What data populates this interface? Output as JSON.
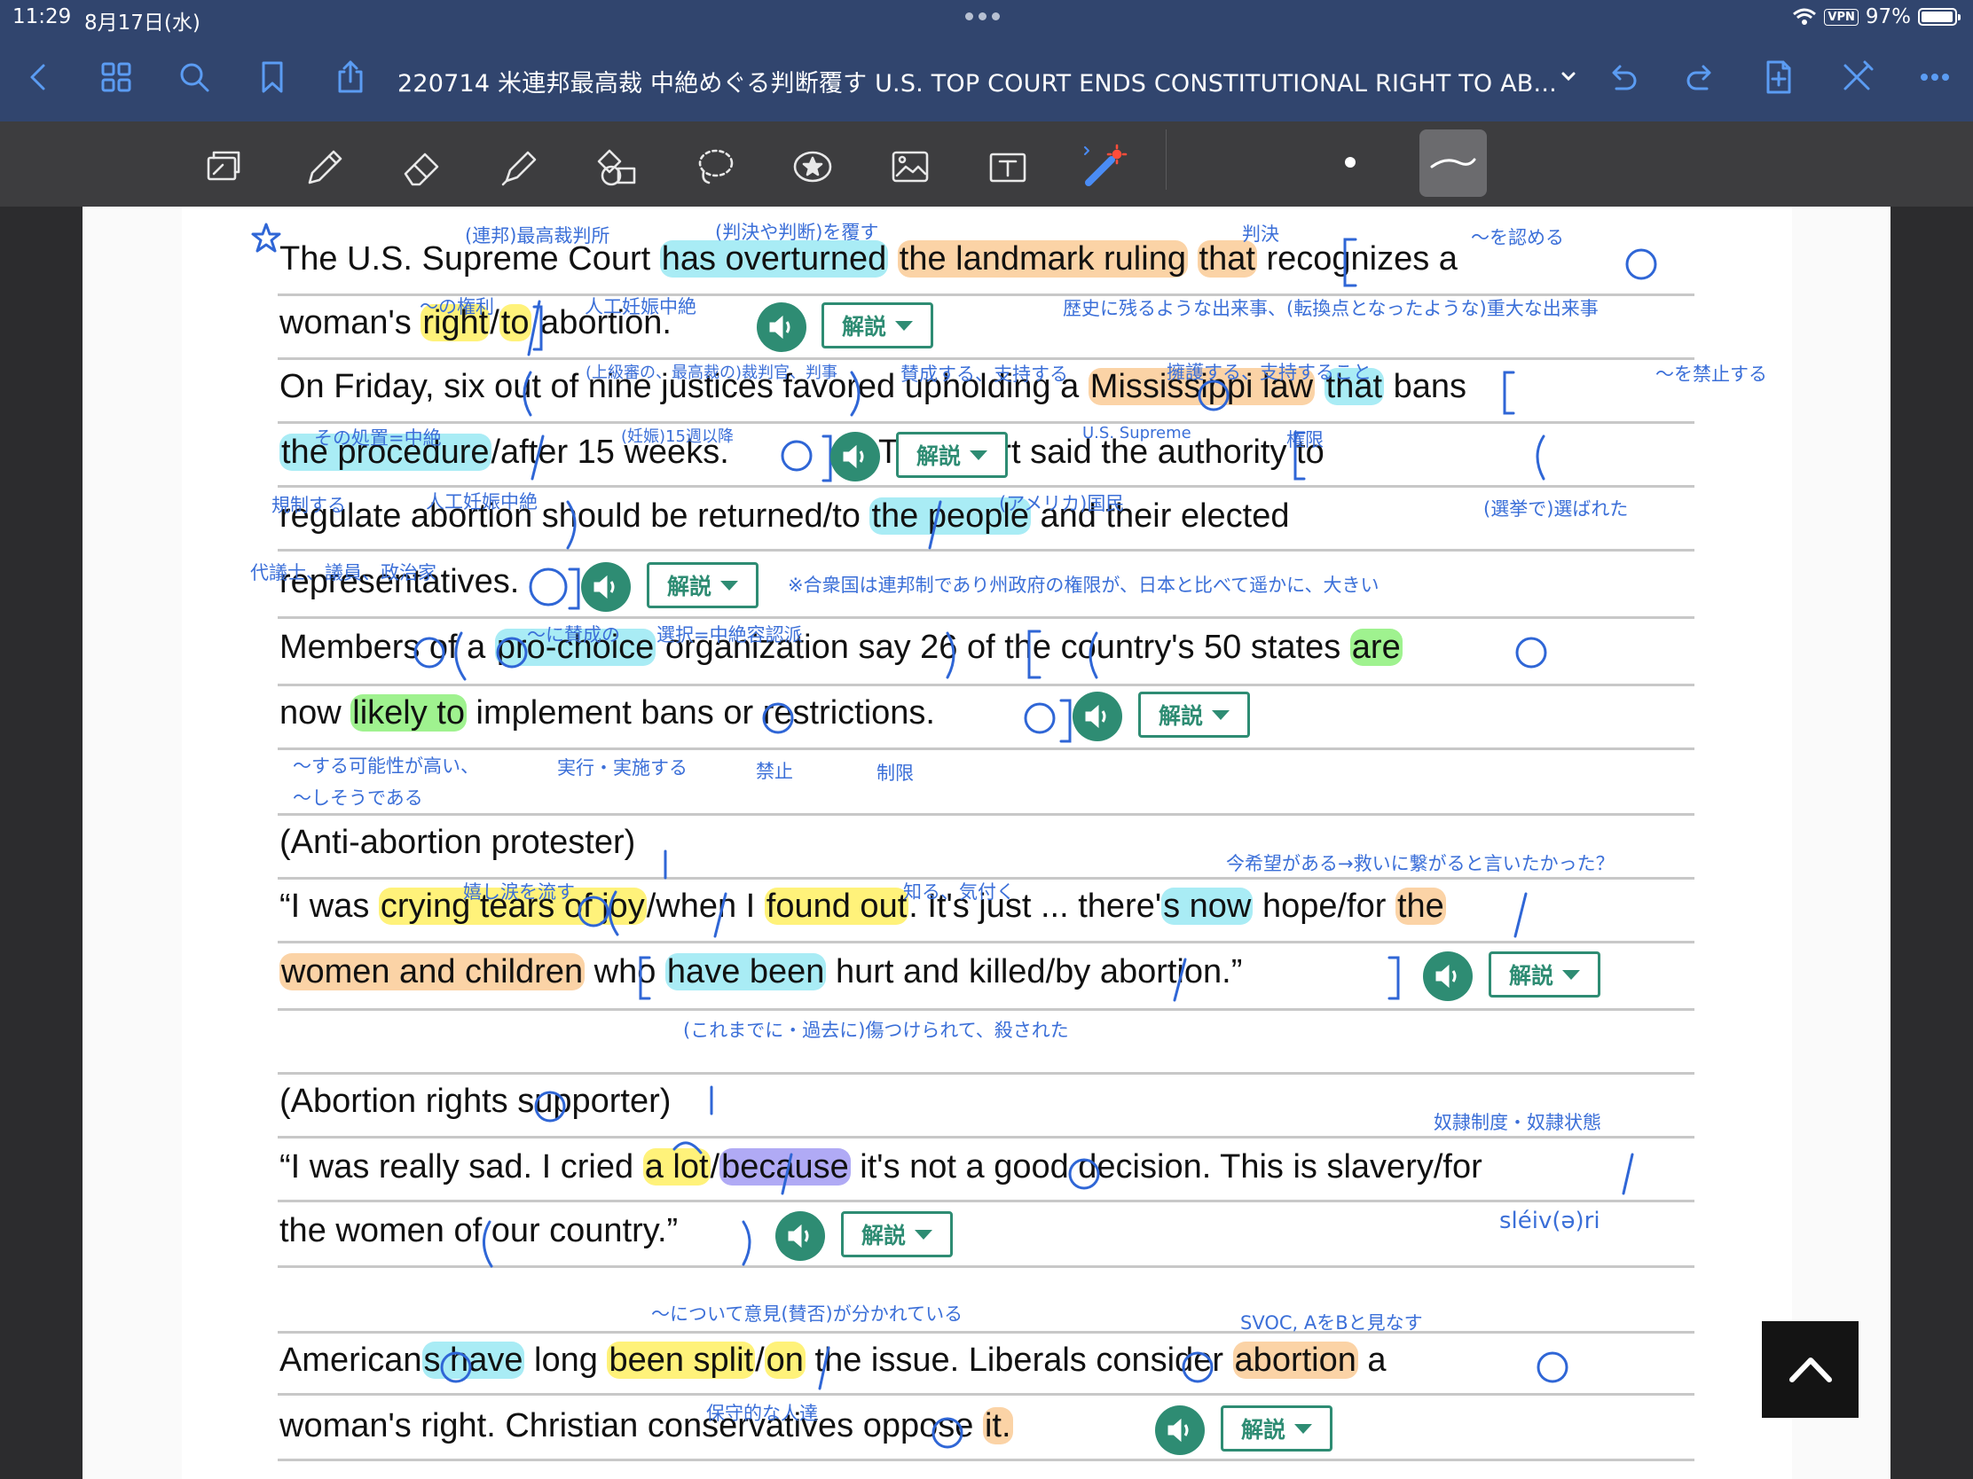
{
  "status": {
    "time": "11:29",
    "date": "8月17日(水)",
    "vpn": "VPN",
    "battery": "97%",
    "battery_level": 0.97
  },
  "nav": {
    "title": "220714 米連邦最高裁 中絶めぐる判断覆す U.S. TOP COURT ENDS CONSTITUTIONAL RIGHT TO AB..."
  },
  "buttons": {
    "explain_label": "解説"
  },
  "lines": [
    {
      "segs": [
        [
          "The U.S. Supreme Court ",
          ""
        ],
        [
          "has overturned",
          "hl-c"
        ],
        [
          " ",
          ""
        ],
        [
          "the landmark ruling",
          "hl-o"
        ],
        [
          " ",
          ""
        ],
        [
          "that",
          "hl-o"
        ],
        [
          " recognizes a",
          ""
        ]
      ]
    },
    {
      "segs": [
        [
          "woman's ",
          ""
        ],
        [
          "right",
          "hl-y"
        ],
        [
          "/",
          ""
        ],
        [
          "to",
          "hl-y"
        ],
        [
          " abortion.",
          ""
        ]
      ]
    },
    {
      "segs": [
        [
          "On Friday, six out of nine justices favored upholding a ",
          ""
        ],
        [
          "Mississippi law",
          "hl-o"
        ],
        [
          " ",
          ""
        ],
        [
          "that",
          "hl-c"
        ],
        [
          " bans",
          ""
        ]
      ]
    },
    {
      "segs": [
        [
          "the procedure",
          "hl-c"
        ],
        [
          "/after 15 weeks.",
          ""
        ],
        [
          "                ",
          ""
        ],
        [
          "The court said the authority to",
          ""
        ]
      ]
    },
    {
      "segs": [
        [
          "regulate abortion should be returned/to ",
          ""
        ],
        [
          "the people",
          "hl-c"
        ],
        [
          " and their elected",
          ""
        ]
      ]
    },
    {
      "segs": [
        [
          "representatives.",
          ""
        ]
      ]
    },
    {
      "segs": [
        [
          "Members of a ",
          ""
        ],
        [
          "pro-choice",
          "hl-c"
        ],
        [
          " organization say 26 of the country's 50 states ",
          ""
        ],
        [
          "are",
          "hl-g"
        ]
      ]
    },
    {
      "segs": [
        [
          "now ",
          ""
        ],
        [
          "likely to",
          "hl-g"
        ],
        [
          " implement bans or restrictions.",
          ""
        ]
      ]
    },
    {
      "segs": [
        [
          "(Anti-abortion protester)",
          ""
        ]
      ]
    },
    {
      "segs": [
        [
          "“I was ",
          ""
        ],
        [
          "crying tears of joy",
          "hl-y"
        ],
        [
          "/when I ",
          ""
        ],
        [
          "found out",
          "hl-y"
        ],
        [
          ". It's just ... there'",
          ""
        ],
        [
          "s now",
          "hl-c"
        ],
        [
          " hope/for ",
          ""
        ],
        [
          "the",
          "hl-o"
        ]
      ]
    },
    {
      "segs": [
        [
          "women and children",
          "hl-o"
        ],
        [
          " who ",
          ""
        ],
        [
          "have been",
          "hl-c"
        ],
        [
          " hurt and killed/by abortion.”",
          ""
        ]
      ]
    },
    {
      "segs": [
        [
          "(Abortion rights supporter)",
          ""
        ]
      ]
    },
    {
      "segs": [
        [
          "“I was really sad. I cried ",
          ""
        ],
        [
          "a lot",
          "hl-y"
        ],
        [
          "/",
          ""
        ],
        [
          "because",
          "hl-p"
        ],
        [
          " it's not a good decision. This is slavery/for",
          ""
        ]
      ]
    },
    {
      "segs": [
        [
          "the women of our country.”",
          ""
        ]
      ]
    },
    {
      "segs": [
        [
          "American",
          ""
        ],
        [
          "s have",
          "hl-c"
        ],
        [
          " long ",
          ""
        ],
        [
          "been split",
          "hl-y"
        ],
        [
          "/",
          ""
        ],
        [
          "on",
          "hl-y"
        ],
        [
          " the issue. Liberals consider ",
          ""
        ],
        [
          "abortion",
          "hl-o"
        ],
        [
          " a",
          ""
        ]
      ]
    },
    {
      "segs": [
        [
          "woman's right. Christian conservatives oppose ",
          ""
        ],
        [
          "it.",
          "hl-o"
        ]
      ]
    }
  ],
  "notes": [
    "(連邦)最高裁判所",
    "(判決や判断)を覆す",
    "判決",
    "〜を認める",
    "〜の権利",
    "人工妊娠中絶",
    "歴史に残るような出来事、(転換点となったような)重大な出来事",
    "(上級審の、最高裁の)裁判官、判事",
    "賛成する、支持する",
    "擁護する、支持すること",
    "〜を禁止する",
    "その処置=中絶",
    "(妊娠)15週以降",
    "U.S. Supreme",
    "権限",
    "規制する",
    "人工妊娠中絶",
    "(アメリカ)国民",
    "(選挙で)選ばれた",
    "代議士、議員、政治家",
    "※合衆国は連邦制であり州政府の権限が、日本と比べて遥かに、大きい",
    "〜に賛成の",
    "選択=中絶容認派",
    "〜する可能性が高い、",
    "〜しそうである",
    "実行・実施する",
    "禁止",
    "制限",
    "今希望がある→救いに繋がると言いたかった？",
    "嬉し涙を流す",
    "知る、気付く",
    "(これまでに・過去に)傷つけられて、殺された",
    "奴隷制度・奴隷状態",
    "sléiv(ə)ri",
    "〜について意見(賛否)が分かれている",
    "SVOC, AをBと見なす",
    "保守的な人達"
  ]
}
